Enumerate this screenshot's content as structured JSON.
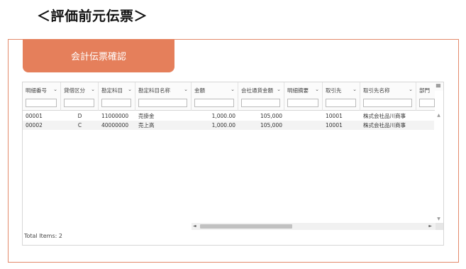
{
  "page": {
    "heading": "＜評価前元伝票＞"
  },
  "tab": {
    "label": "会計伝票確認"
  },
  "grid": {
    "columns": [
      {
        "label": "明細番号",
        "chevron": "⌄"
      },
      {
        "label": "貸借区分",
        "chevron": "⌄"
      },
      {
        "label": "勘定科目",
        "chevron": "⌄"
      },
      {
        "label": "勘定科目名称",
        "chevron": "⌄"
      },
      {
        "label": "金額",
        "chevron": "⌄"
      },
      {
        "label": "会社通貨金額",
        "chevron": "⌄"
      },
      {
        "label": "明細摘要",
        "chevron": "⌄"
      },
      {
        "label": "取引先",
        "chevron": "⌄"
      },
      {
        "label": "取引先名称",
        "chevron": "⌄"
      },
      {
        "label": "部門"
      }
    ],
    "rows": [
      [
        "00001",
        "D",
        "11000000",
        "売掛金",
        "1,000.00",
        "105,000",
        "",
        "10001",
        "株式会社品川商事"
      ],
      [
        "00002",
        "C",
        "40000000",
        "売上高",
        "1,000.00",
        "105,000",
        "",
        "10001",
        "株式会社品川商事"
      ]
    ],
    "menu_icon": "≡",
    "scroll": {
      "up": "▲",
      "down": "▼",
      "left": "◄",
      "right": "►"
    },
    "footer": "Total Items: 2"
  }
}
